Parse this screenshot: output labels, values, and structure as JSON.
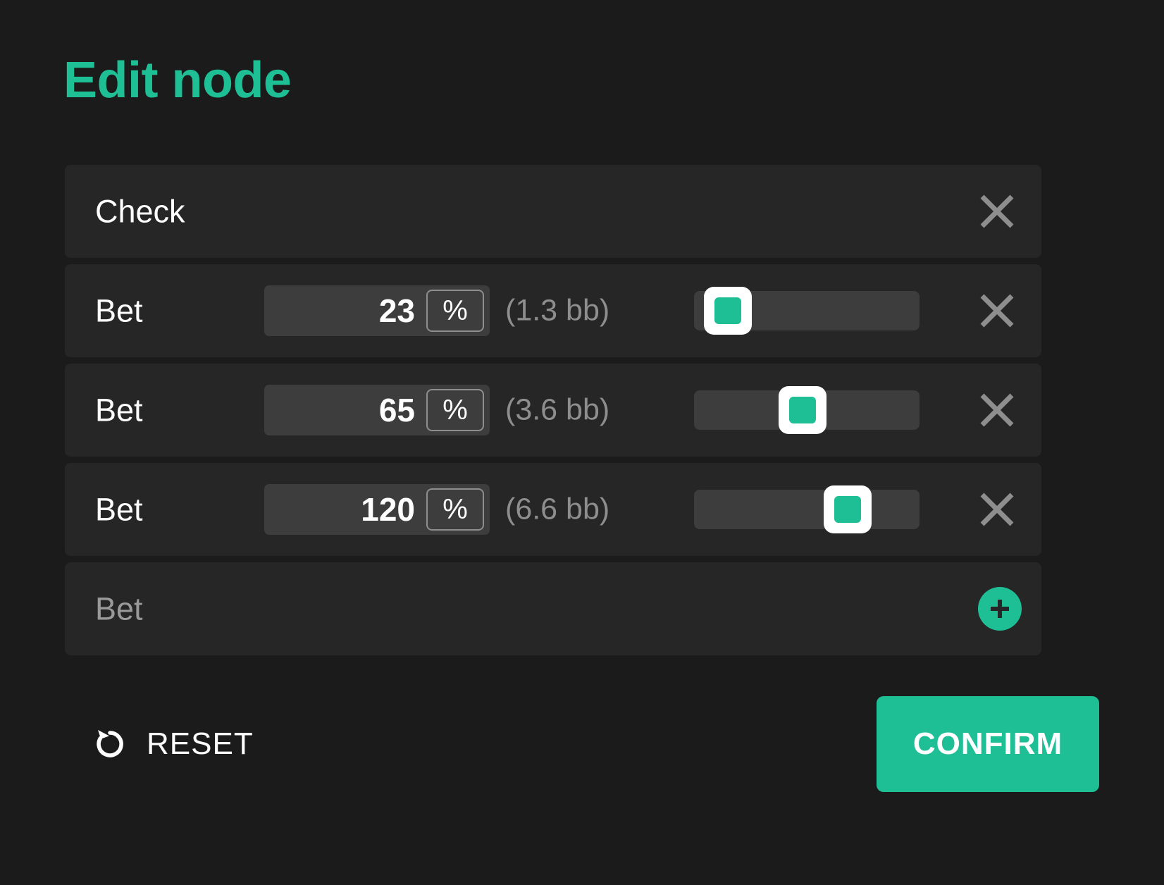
{
  "title": "Edit node",
  "accent_color": "#1fbf96",
  "background_color": "#1b1b1b",
  "row_background_color": "#262626",
  "secondary_text_color": "#8e8e8e",
  "rows": [
    {
      "label": "Check",
      "type": "check",
      "has_amount": false,
      "has_slider": false,
      "remove_icon": "close-icon"
    },
    {
      "label": "Bet",
      "type": "bet",
      "has_amount": true,
      "amount": "23",
      "unit": "%",
      "bb": "(1.3 bb)",
      "has_slider": true,
      "slider_percent": 15,
      "remove_icon": "close-icon"
    },
    {
      "label": "Bet",
      "type": "bet",
      "has_amount": true,
      "amount": "65",
      "unit": "%",
      "bb": "(3.6 bb)",
      "has_slider": true,
      "slider_percent": 48,
      "remove_icon": "close-icon"
    },
    {
      "label": "Bet",
      "type": "bet",
      "has_amount": true,
      "amount": "120",
      "unit": "%",
      "bb": "(6.6 bb)",
      "has_slider": true,
      "slider_percent": 68,
      "remove_icon": "close-icon"
    },
    {
      "label": "Bet",
      "type": "add",
      "has_amount": false,
      "has_slider": false,
      "add_icon": "plus-icon"
    }
  ],
  "footer": {
    "reset_label": "RESET",
    "reset_icon": "rotate-counterclockwise-icon",
    "confirm_label": "CONFIRM"
  }
}
